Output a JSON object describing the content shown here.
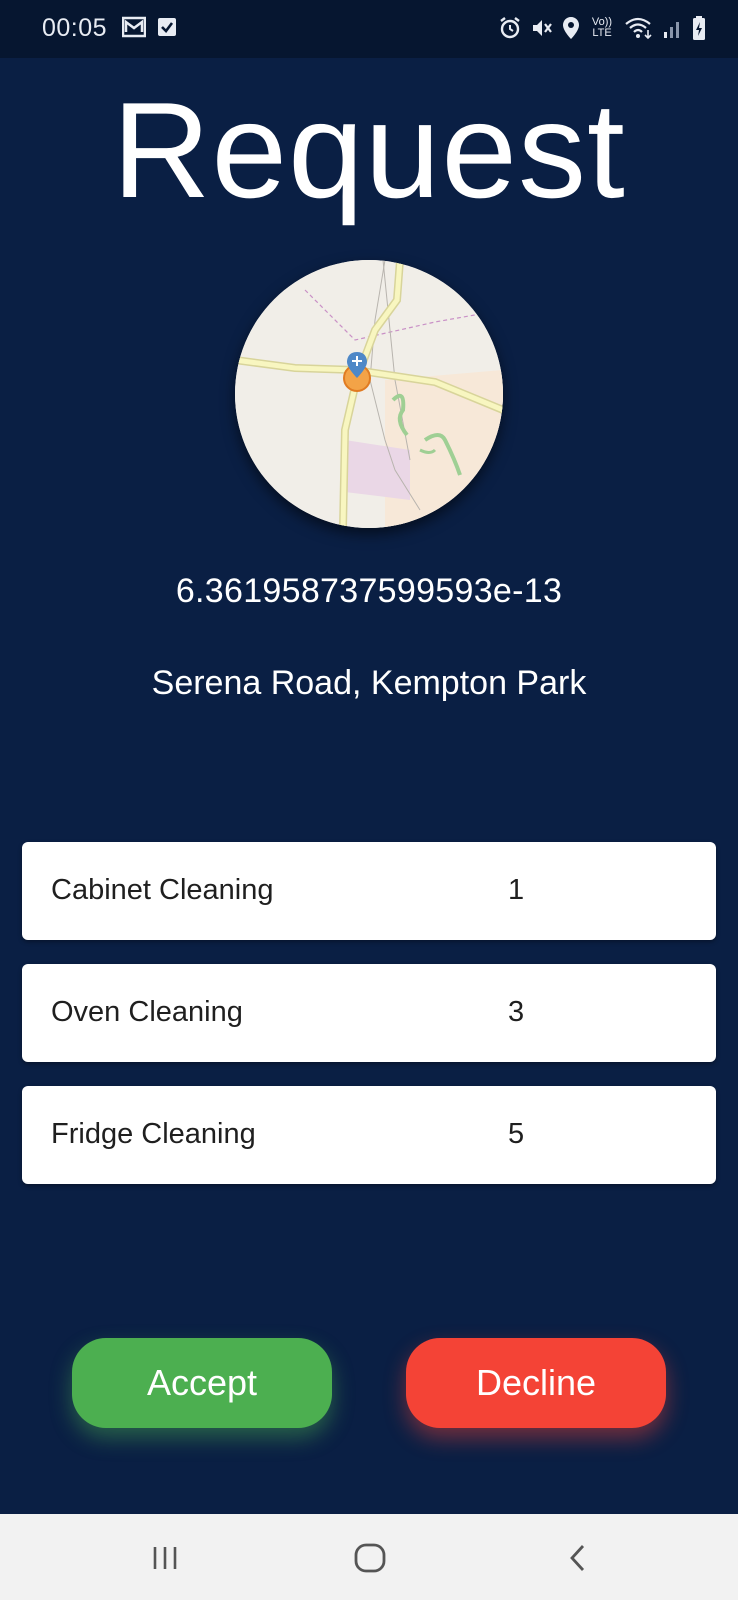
{
  "status_bar": {
    "time": "00:05",
    "icons": [
      "gmail-icon",
      "checkbox-notification-icon",
      "alarm-icon",
      "mute-icon",
      "location-icon",
      "volte-icon",
      "wifi-icon",
      "signal-icon",
      "battery-icon"
    ],
    "volte_top": "Vo))",
    "volte_bottom": "LTE"
  },
  "page": {
    "title": "Request",
    "coordinate": "6.361958737599593e-13",
    "address": "Serena Road, Kempton Park"
  },
  "services": [
    {
      "name": "Cabinet Cleaning",
      "quantity": "1"
    },
    {
      "name": "Oven Cleaning",
      "quantity": "3"
    },
    {
      "name": "Fridge Cleaning",
      "quantity": "5"
    }
  ],
  "actions": {
    "accept_label": "Accept",
    "decline_label": "Decline"
  },
  "colors": {
    "background": "#0a1f44",
    "accept": "#4caf50",
    "decline": "#f44336",
    "card": "#ffffff"
  },
  "nav_bar": {
    "icons": [
      "recent-apps-icon",
      "home-icon",
      "back-icon"
    ]
  }
}
